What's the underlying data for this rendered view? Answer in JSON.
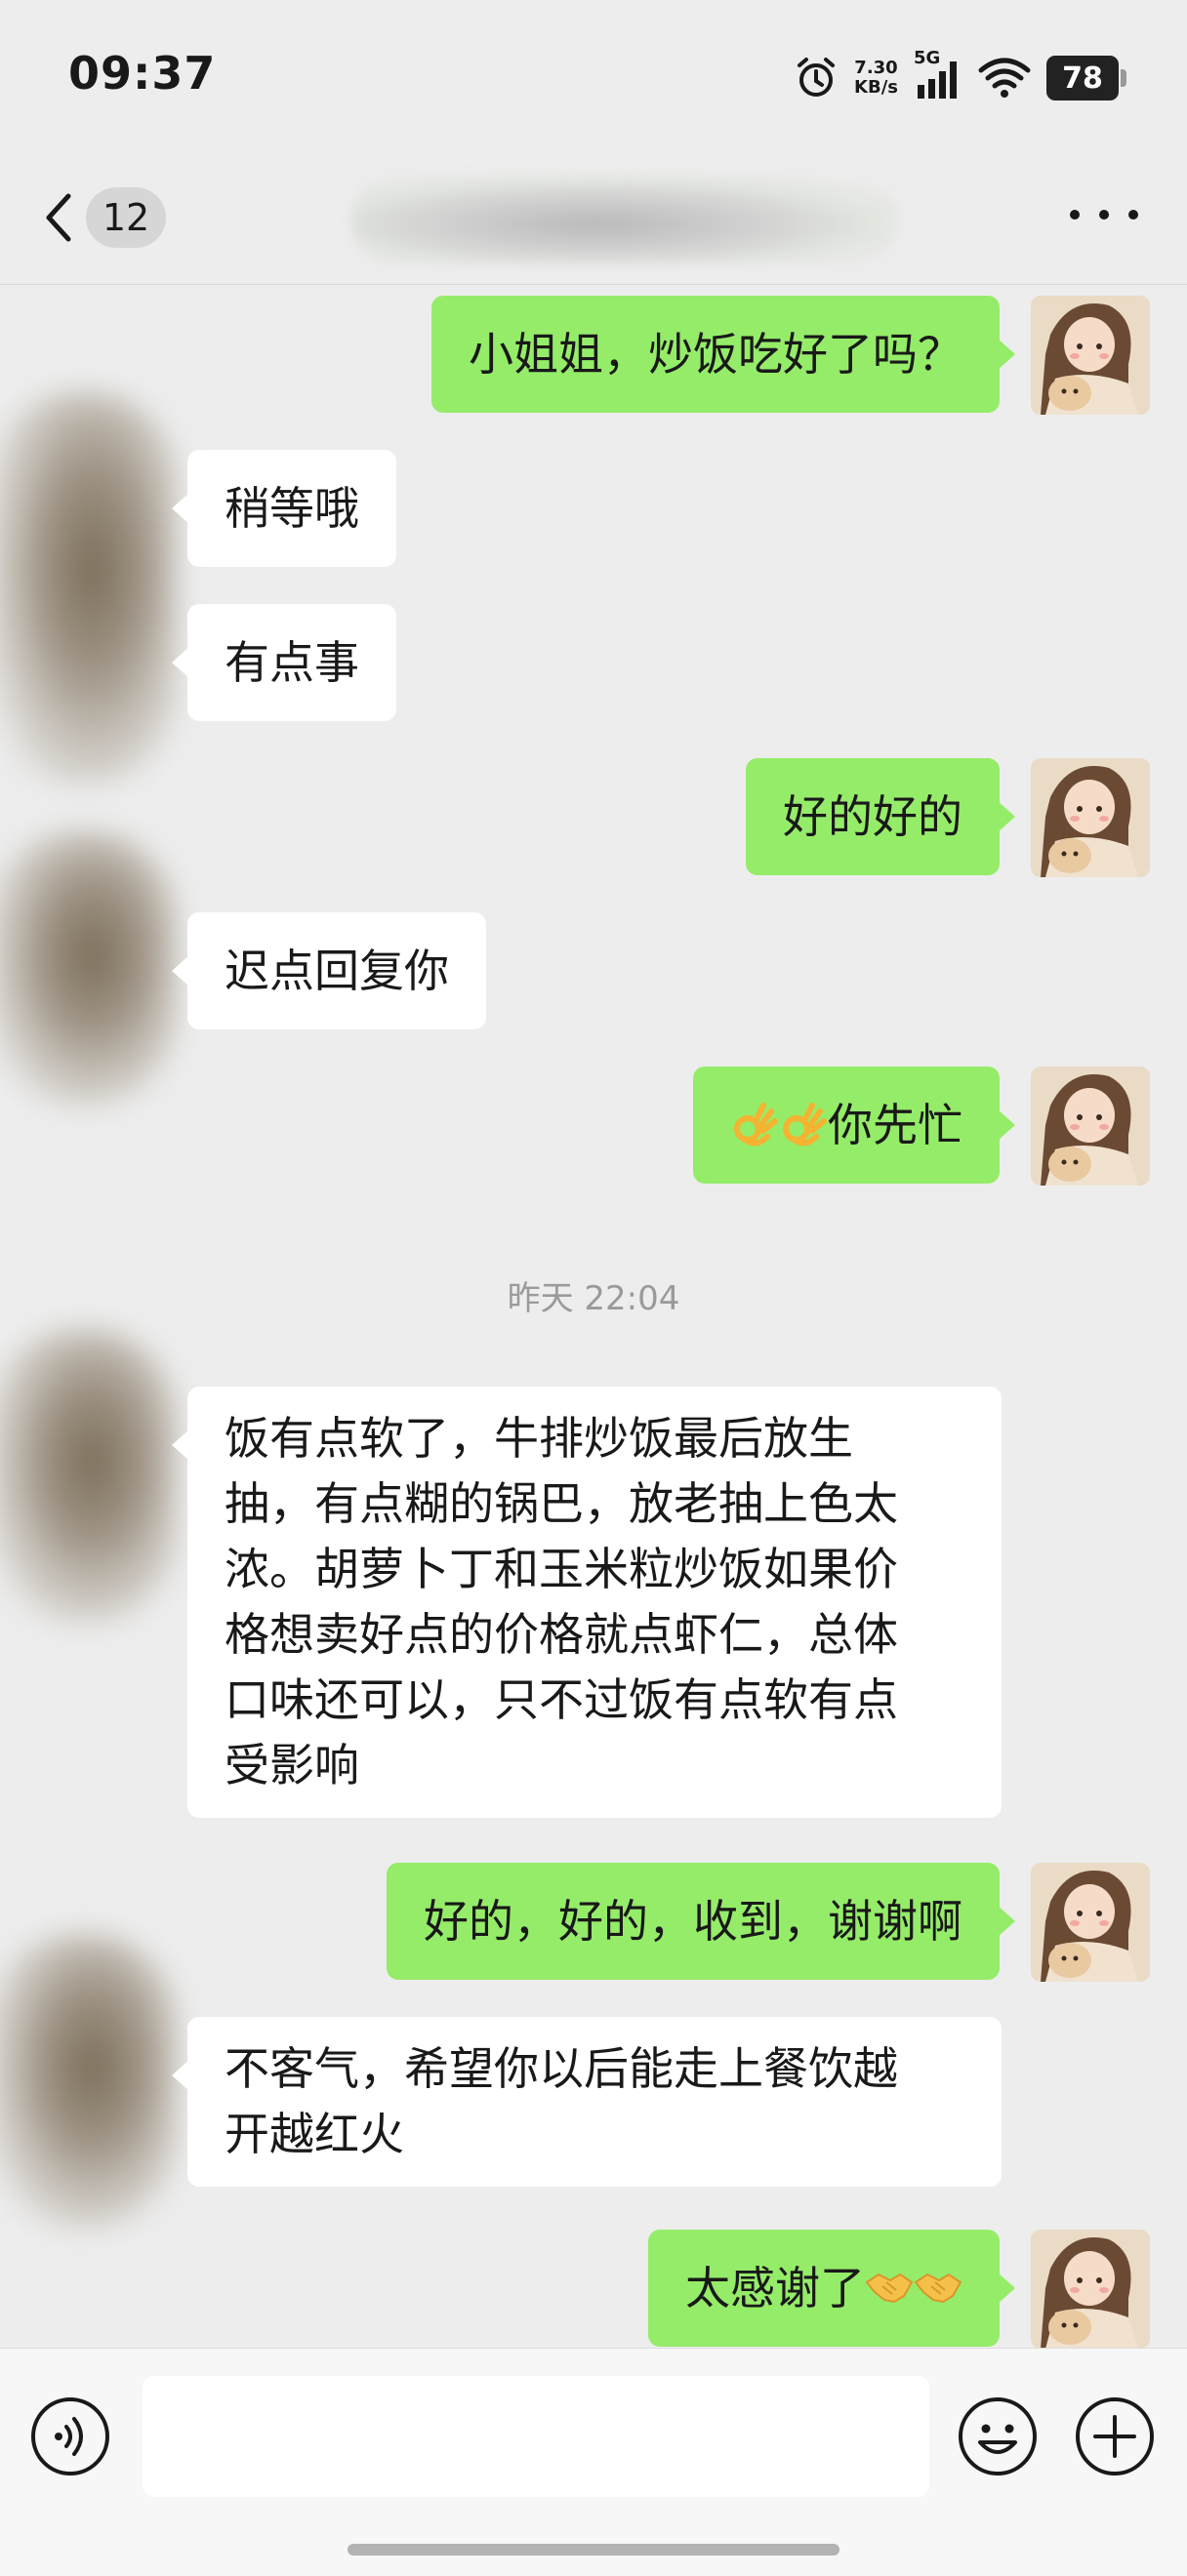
{
  "status_bar": {
    "time": "09:37",
    "net_speed_value": "7.30",
    "net_speed_unit": "KB/s",
    "network_type": "5G",
    "battery": "78"
  },
  "nav": {
    "unread_count": "12",
    "chat_title_blurred": true
  },
  "colors": {
    "background": "#ededed",
    "outgoing_bubble": "#95ec69",
    "incoming_bubble": "#ffffff"
  },
  "messages": [
    {
      "side": "out",
      "text": "小姐姐，炒饭吃好了吗？"
    },
    {
      "side": "in",
      "text": "稍等哦"
    },
    {
      "side": "in",
      "text": "有点事"
    },
    {
      "side": "out",
      "text": "好的好的"
    },
    {
      "side": "in",
      "text": "迟点回复你"
    },
    {
      "side": "out",
      "emoji": [
        "ok-hand-emoji",
        "ok-hand-emoji"
      ],
      "text": "你先忙"
    },
    {
      "type": "timestamp",
      "text": "昨天 22:04"
    },
    {
      "side": "in",
      "lines": [
        "饭有点软了，牛排炒饭最后放生",
        "抽，有点糊的锅巴，放老抽上色太",
        "浓。胡萝卜丁和玉米粒炒饭如果价",
        "格想卖好点的价格就点虾仁，总体",
        "口味还可以，只不过饭有点软有点",
        "受影响"
      ]
    },
    {
      "side": "out",
      "text": "好的，好的，收到，谢谢啊"
    },
    {
      "side": "in",
      "lines": [
        "不客气，希望你以后能走上餐饮越",
        "开越红火"
      ]
    },
    {
      "side": "out",
      "text": "太感谢了",
      "emoji_after": [
        "handshake-emoji",
        "handshake-emoji"
      ]
    }
  ],
  "input": {
    "placeholder": ""
  }
}
